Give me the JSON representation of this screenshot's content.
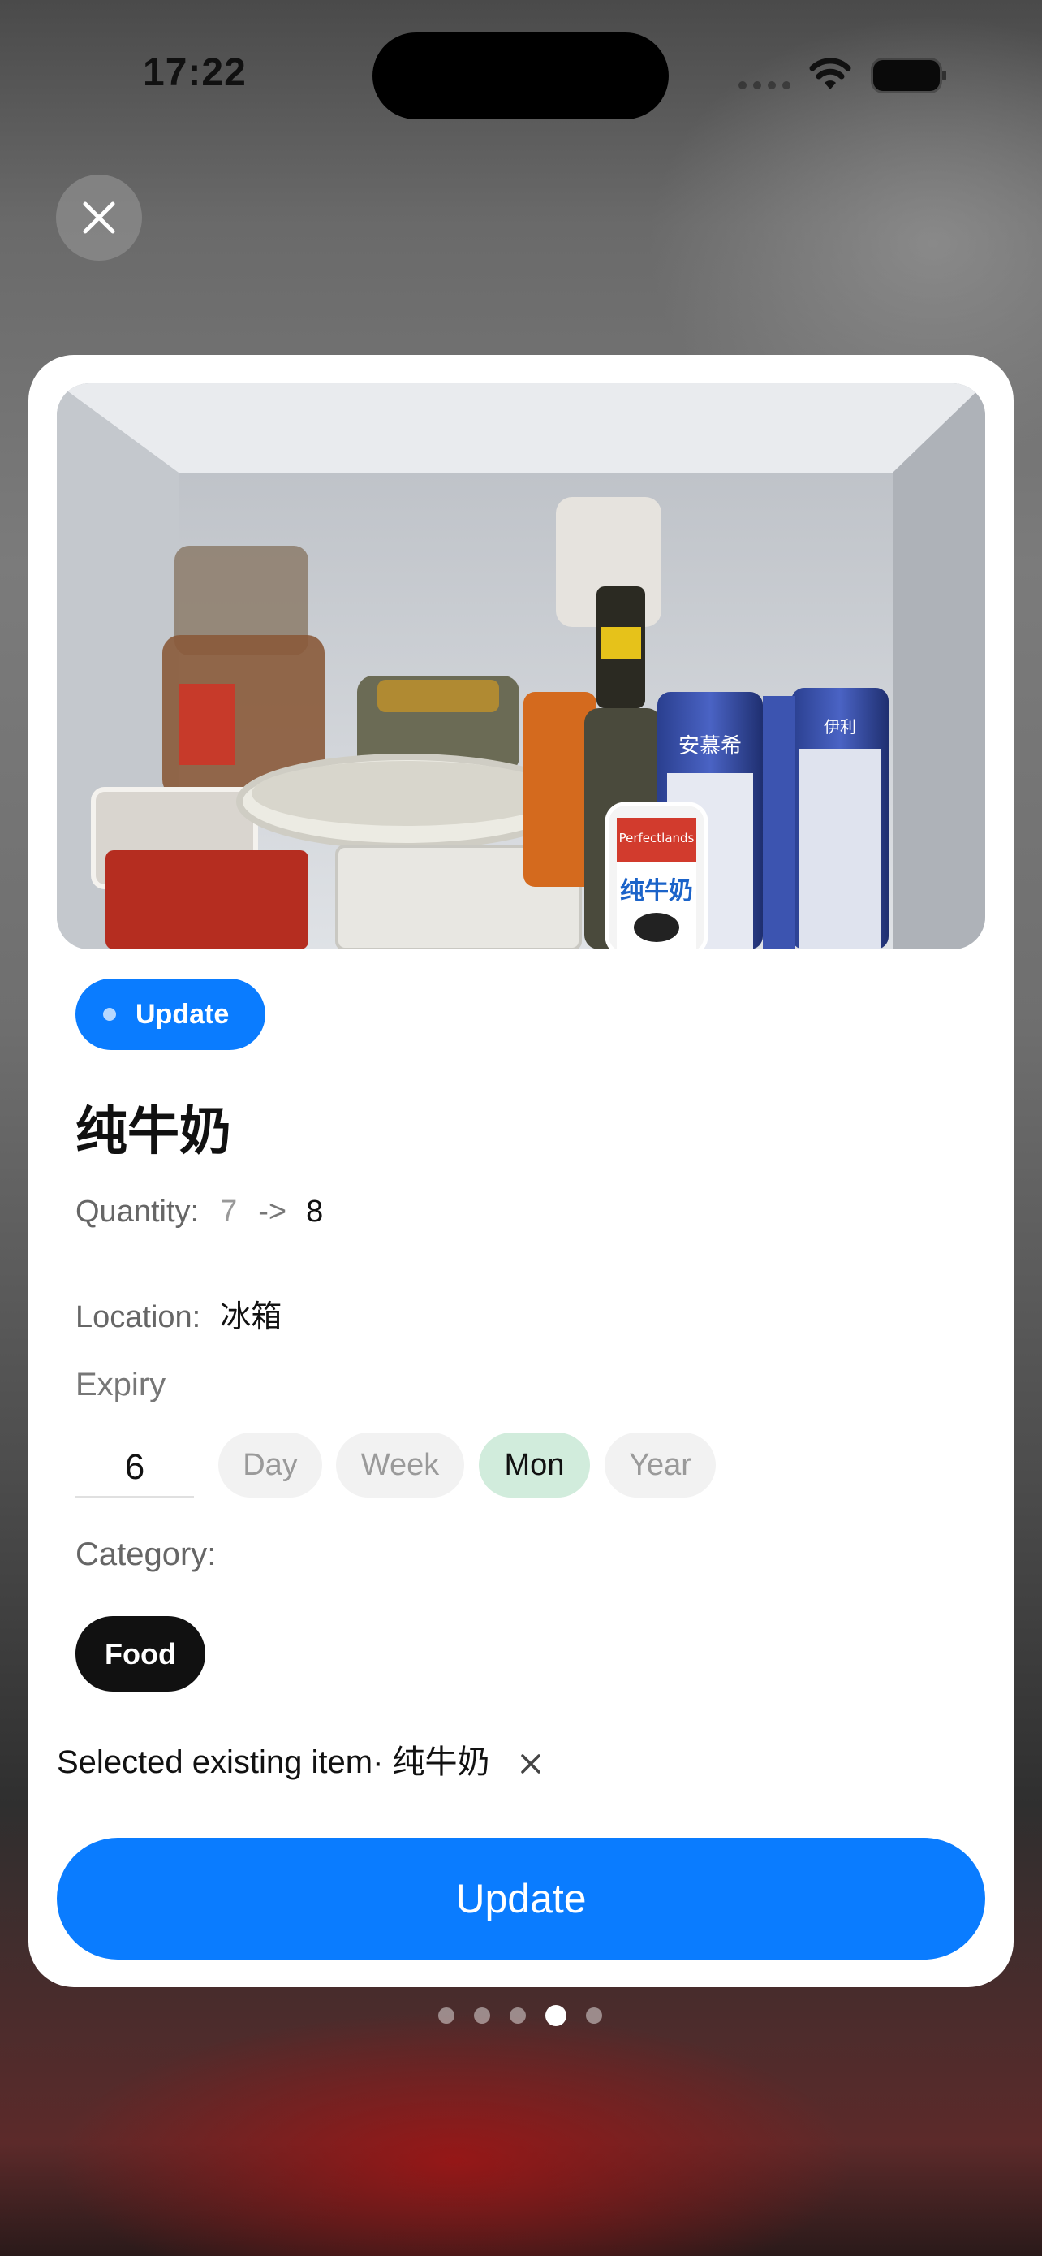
{
  "status_bar": {
    "time": "17:22"
  },
  "header": {
    "close_icon": "close-icon"
  },
  "item": {
    "badge_label": "Update",
    "title": "纯牛奶",
    "quantity_label": "Quantity:",
    "quantity_old": "7",
    "quantity_arrow": "->",
    "quantity_new": "8",
    "location_label": "Location:",
    "location_value": "冰箱",
    "expiry_label": "Expiry",
    "expiry_value": "6",
    "expiry_units": [
      "Day",
      "Week",
      "Mon",
      "Year"
    ],
    "expiry_selected_unit": "Mon",
    "category_label": "Category:",
    "category_selected": "Food",
    "selected_existing": "Selected existing item· 纯牛奶",
    "update_button": "Update"
  },
  "pager": {
    "count": 5,
    "active_index": 3
  },
  "colors": {
    "accent": "#0a7cff",
    "selected_unit_bg": "#d1ecdc",
    "chip_bg": "#111111"
  },
  "photo": {
    "product_labels": [
      "Perfectlands",
      "纯牛奶",
      "安慕希",
      "伊利"
    ]
  }
}
